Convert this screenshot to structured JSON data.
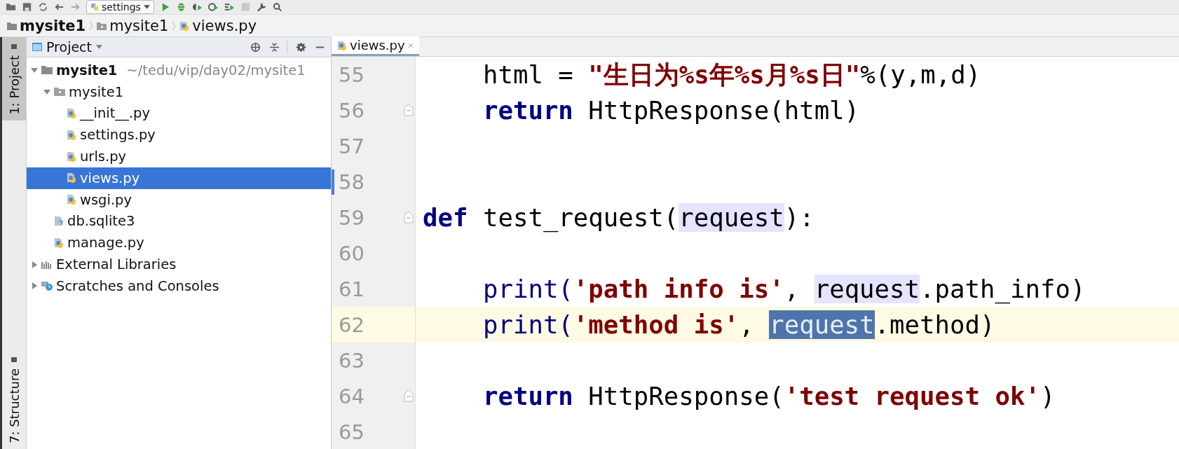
{
  "toolbar": {
    "run_config": "settings"
  },
  "breadcrumbs": [
    {
      "label": "mysite1",
      "kind": "project"
    },
    {
      "label": "mysite1",
      "kind": "folder"
    },
    {
      "label": "views.py",
      "kind": "python"
    }
  ],
  "side_tabs": [
    {
      "label": "1: Project",
      "selected": true
    },
    {
      "label": "7: Structure",
      "selected": false
    }
  ],
  "project_panel": {
    "title": "Project"
  },
  "tree": [
    {
      "name": "mysite1",
      "note": "~/tedu/vip/day02/mysite1",
      "kind": "project",
      "expanded": true,
      "selected": false,
      "children": [
        {
          "name": "mysite1",
          "kind": "folder",
          "expanded": true,
          "selected": false,
          "children": [
            {
              "name": "__init__.py",
              "kind": "python",
              "selected": false
            },
            {
              "name": "settings.py",
              "kind": "python",
              "selected": false
            },
            {
              "name": "urls.py",
              "kind": "python",
              "selected": false
            },
            {
              "name": "views.py",
              "kind": "python",
              "selected": true
            },
            {
              "name": "wsgi.py",
              "kind": "python",
              "selected": false
            }
          ]
        },
        {
          "name": "db.sqlite3",
          "kind": "unknown",
          "selected": false
        },
        {
          "name": "manage.py",
          "kind": "python",
          "selected": false
        }
      ]
    },
    {
      "name": "External Libraries",
      "kind": "libraries",
      "expanded": false,
      "selected": false
    },
    {
      "name": "Scratches and Consoles",
      "kind": "scratches",
      "expanded": false,
      "selected": false
    }
  ],
  "editor_tabs": [
    {
      "label": "views.py",
      "selected": true
    }
  ],
  "code_lines": [
    {
      "number": "55",
      "current": false,
      "changed": false,
      "fold": false,
      "segments": [
        {
          "text": "    html = ",
          "kind": "plain"
        },
        {
          "text": "\"生日为%s年%s月%s日\"",
          "kind": "string"
        },
        {
          "text": "%(y,m,d)",
          "kind": "plain"
        }
      ]
    },
    {
      "number": "56",
      "current": false,
      "changed": false,
      "fold": true,
      "segments": [
        {
          "text": "    return",
          "kind": "keyword"
        },
        {
          "text": " HttpResponse(html)",
          "kind": "plain"
        }
      ]
    },
    {
      "number": "57",
      "current": false,
      "changed": false,
      "fold": false
    },
    {
      "number": "58",
      "current": false,
      "changed": true,
      "fold": false
    },
    {
      "number": "59",
      "current": false,
      "changed": false,
      "fold": true,
      "segments": [
        {
          "text": "def",
          "kind": "keyword"
        },
        {
          "text": " test_request(",
          "kind": "plain"
        },
        {
          "text": "request",
          "kind": "usage"
        },
        {
          "text": "):",
          "kind": "plain"
        }
      ]
    },
    {
      "number": "60",
      "current": false,
      "changed": false,
      "fold": false
    },
    {
      "number": "61",
      "current": false,
      "changed": false,
      "fold": false,
      "segments": [
        {
          "text": "    print(",
          "kind": "builtin"
        },
        {
          "text": "'path info is'",
          "kind": "string"
        },
        {
          "text": ", ",
          "kind": "plain"
        },
        {
          "text": "request",
          "kind": "usage"
        },
        {
          "text": ".path_info)",
          "kind": "plain"
        }
      ]
    },
    {
      "number": "62",
      "current": true,
      "changed": false,
      "fold": false,
      "segments": [
        {
          "text": "    print(",
          "kind": "builtin"
        },
        {
          "text": "'method is'",
          "kind": "string"
        },
        {
          "text": ", ",
          "kind": "plain"
        },
        {
          "text": "request",
          "kind": "selection"
        },
        {
          "text": ".method)",
          "kind": "plain"
        }
      ]
    },
    {
      "number": "63",
      "current": false,
      "changed": false,
      "fold": false
    },
    {
      "number": "64",
      "current": false,
      "changed": false,
      "fold": true,
      "segments": [
        {
          "text": "    return",
          "kind": "keyword"
        },
        {
          "text": " HttpResponse(",
          "kind": "plain"
        },
        {
          "text": "'test request ok'",
          "kind": "string"
        },
        {
          "text": ")",
          "kind": "plain"
        }
      ]
    },
    {
      "number": "65",
      "current": false,
      "changed": false,
      "fold": false
    }
  ]
}
